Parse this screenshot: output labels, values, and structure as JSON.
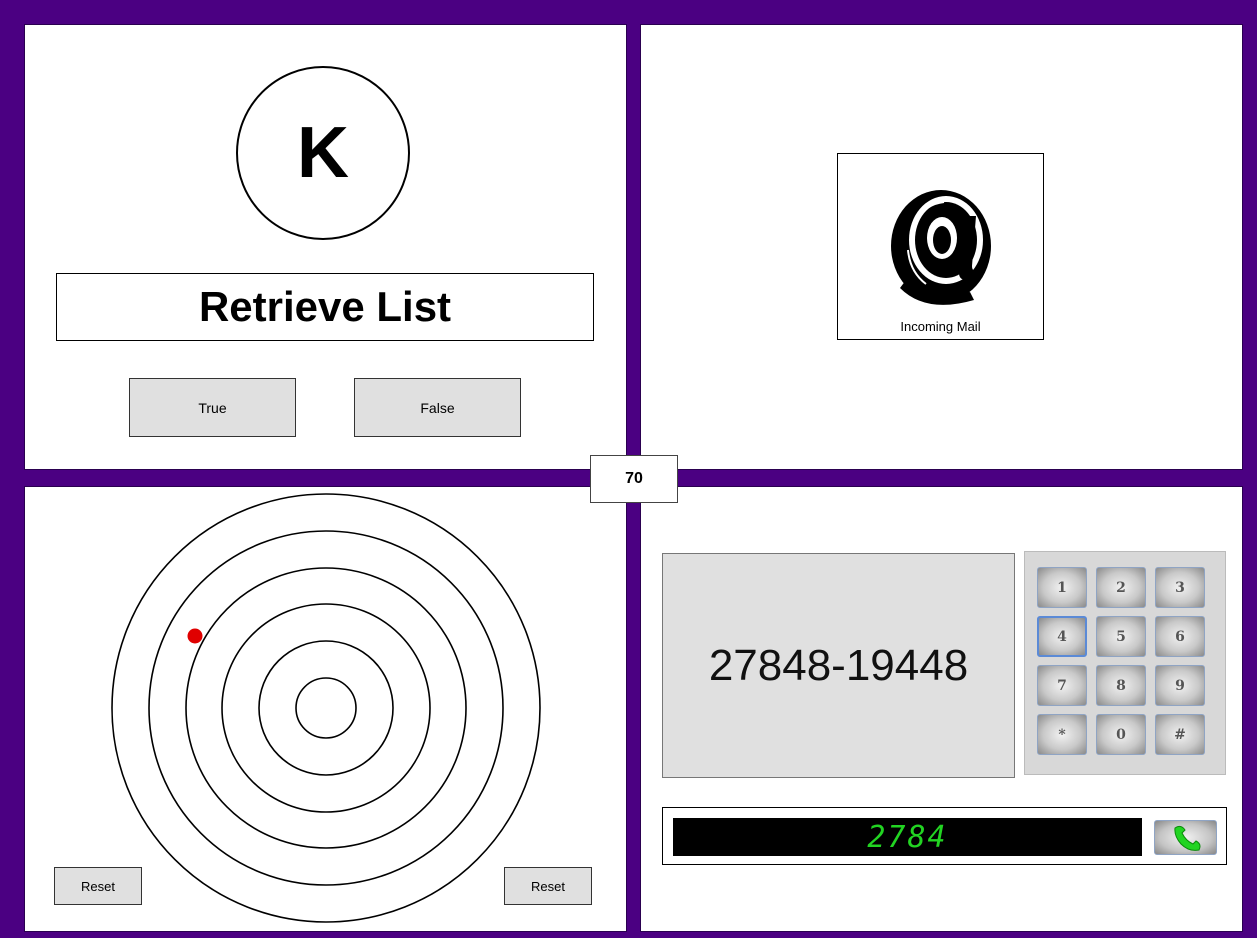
{
  "colors": {
    "frame": "#4b0082",
    "target_dot": "#e00000",
    "dial_text": "#22d422"
  },
  "top_left": {
    "letter": "K",
    "task_text": "Retrieve List",
    "true_label": "True",
    "false_label": "False"
  },
  "top_right": {
    "icon": "at-sign-icon",
    "mail_label": "Incoming Mail"
  },
  "counter": "70",
  "bottom_left": {
    "ring_count": 6,
    "reset_left_label": "Reset",
    "reset_right_label": "Reset"
  },
  "bottom_right": {
    "display_number": "27848-19448",
    "keys": [
      "1",
      "2",
      "3",
      "4",
      "5",
      "6",
      "7",
      "8",
      "9",
      "*",
      "0",
      "#"
    ],
    "selected_key": "4",
    "dialed": "2784",
    "call_icon": "phone-handset-icon"
  }
}
